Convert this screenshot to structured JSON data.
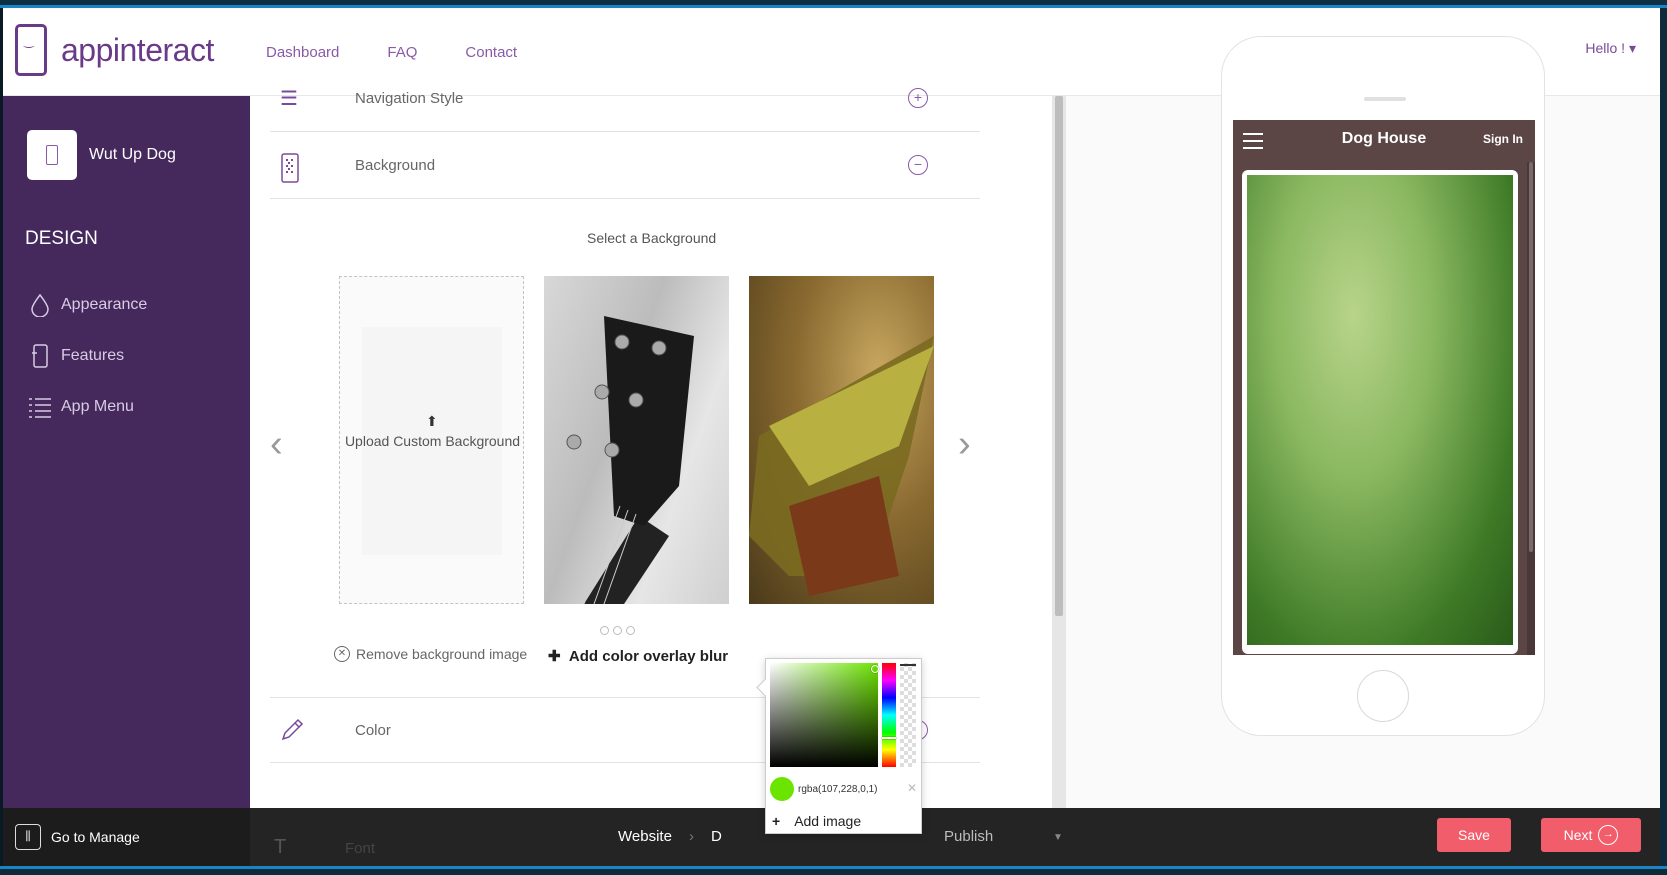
{
  "header": {
    "logo_text": "appinteract",
    "nav": [
      "Dashboard",
      "FAQ",
      "Contact"
    ],
    "greeting": "Hello ! ▾"
  },
  "sidebar": {
    "app_name": "Wut Up Dog",
    "heading": "DESIGN",
    "items": [
      {
        "label": "Appearance",
        "icon": "drop-icon"
      },
      {
        "label": "Features",
        "icon": "phone-feature-icon"
      },
      {
        "label": "App Menu",
        "icon": "list-icon"
      }
    ]
  },
  "sections": {
    "navigation_style": "Navigation Style",
    "background": "Background",
    "color": "Color"
  },
  "background_panel": {
    "select_title": "Select a Background",
    "upload_label": "Upload Custom Background",
    "remove_label": "Remove background image",
    "add_overlay_label": "Add color overlay blur",
    "prev_arrow": "‹",
    "next_arrow": "›"
  },
  "color_picker": {
    "value": "rgba(107,228,0,1)",
    "selected_color": "#6be400",
    "close": "✕",
    "add_image_label": "Add image"
  },
  "preview": {
    "screen_title": "Dog House",
    "sign_in": "Sign In"
  },
  "bottom_bar": {
    "manage_label": "Go to Manage",
    "steps": [
      "Website",
      "D",
      "Publish"
    ],
    "save_label": "Save",
    "next_label": "Next"
  },
  "colors": {
    "brand": "#6a3a8a",
    "sidebar_bg": "#45295c",
    "accent_button": "#f25d6b"
  }
}
